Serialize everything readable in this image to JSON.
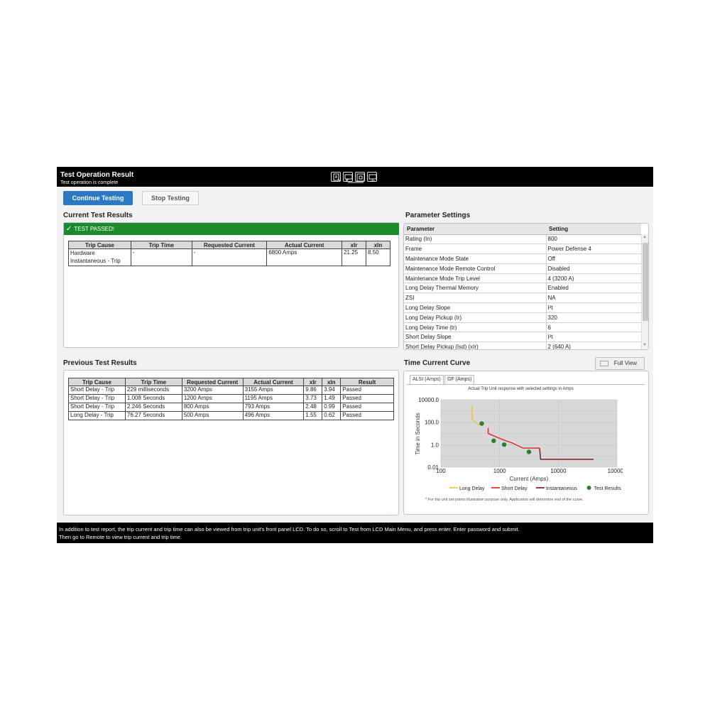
{
  "window": {
    "title": "Test Operation Result",
    "subtitle": "Test operation is complete"
  },
  "toolbar": {
    "icons": [
      "report-icon",
      "comment-icon",
      "screen-icon",
      "monitor-icon"
    ]
  },
  "buttons": {
    "continue_label": "Continue Testing",
    "stop_label": "Stop Testing",
    "full_view_label": "Full View"
  },
  "current_results": {
    "heading": "Current Test Results",
    "status": "TEST PASSED!",
    "status_color": "#1b8a2b",
    "columns": [
      "Trip Cause",
      "Trip Time",
      "Requested Current",
      "Actual Current",
      "xIr",
      "xIn"
    ],
    "rows": [
      [
        "Hardware Instantaneous - Trip",
        "-",
        "-",
        "6800 Amps",
        "21.25",
        "8.50"
      ]
    ]
  },
  "parameters": {
    "heading": "Parameter Settings",
    "columns": [
      "Parameter",
      "Setting"
    ],
    "rows": [
      [
        "Rating (In)",
        "800"
      ],
      [
        "Frame",
        "Power Defense 4"
      ],
      [
        "Maintenance Mode State",
        "Off"
      ],
      [
        "Maintenance Mode Remote Control",
        "Disabled"
      ],
      [
        "Maintenance Mode Trip Level",
        "4 (3200 A)"
      ],
      [
        "Long Delay Thermal Memory",
        "Enabled"
      ],
      [
        "ZSI",
        "NA"
      ],
      [
        "Long Delay Slope",
        "I²t"
      ],
      [
        "Long Delay Pickup (Ir)",
        "320"
      ],
      [
        "Long Delay Time (tr)",
        "6"
      ],
      [
        "Short Delay Slope",
        "I²t"
      ],
      [
        "Short Delay Pickup (Isd) (xIr)",
        "2 (640 A)"
      ]
    ]
  },
  "previous_results": {
    "heading": "Previous Test Results",
    "columns": [
      "Trip Cause",
      "Trip Time",
      "Requested Current",
      "Actual Current",
      "xIr",
      "xIn",
      "Result"
    ],
    "rows": [
      [
        "Short Delay - Trip",
        "229  milliseconds",
        "3200 Amps",
        "3155 Amps",
        "9.86",
        "3.94",
        "Passed"
      ],
      [
        "Short Delay - Trip",
        "1.008 Seconds",
        "1200 Amps",
        "1195 Amps",
        "3.73",
        "1.49",
        "Passed"
      ],
      [
        "Short Delay - Trip",
        "2.246 Seconds",
        "800 Amps",
        "793 Amps",
        "2.48",
        "0.99",
        "Passed"
      ],
      [
        "Long Delay - Trip",
        "76.27 Seconds",
        "500 Amps",
        "496 Amps",
        "1.55",
        "0.62",
        "Passed"
      ]
    ]
  },
  "curve": {
    "heading": "Time Current Curve",
    "tabs": [
      "ALSI (Amps)",
      "GF (Amps)"
    ],
    "caption": "Actual Trip Unit response with selected settings in Amps",
    "note": "* For trip unit set points illustration purpose only. Application will determine end of the curve."
  },
  "chart_data": {
    "type": "line",
    "xlabel": "Current (Amps)",
    "ylabel": "Time in Seconds",
    "xscale": "log",
    "yscale": "log",
    "xlim": [
      100,
      100000
    ],
    "ylim": [
      0.01,
      10000
    ],
    "x_ticks": [
      "100",
      "1000",
      "10000",
      "100000"
    ],
    "y_ticks": [
      "0.01",
      "1.0",
      "100.0",
      "10000.0"
    ],
    "legend_position": "bottom",
    "series": [
      {
        "name": "Long Delay",
        "color": "#f0c419",
        "points": [
          [
            340,
            3000
          ],
          [
            340,
            200
          ],
          [
            400,
            80
          ],
          [
            500,
            50
          ]
        ]
      },
      {
        "name": "Short Delay",
        "color": "#e02020",
        "points": [
          [
            640,
            30
          ],
          [
            640,
            10
          ],
          [
            800,
            6
          ],
          [
            1200,
            2.5
          ],
          [
            1600,
            1.5
          ],
          [
            2500,
            0.5
          ],
          [
            4800,
            0.5
          ]
        ]
      },
      {
        "name": "Instantaneous",
        "color": "#7a0f0f",
        "points": [
          [
            4800,
            0.5
          ],
          [
            5000,
            0.05
          ],
          [
            40000,
            0.05
          ]
        ]
      }
    ],
    "test_results": {
      "name": "Test Results",
      "color": "#2e7d32",
      "points": [
        [
          496,
          76.27
        ],
        [
          793,
          2.246
        ],
        [
          1195,
          1.008
        ],
        [
          3155,
          0.229
        ]
      ]
    }
  },
  "footer": {
    "line1": "In addition to test report, the trip current and trip time can also be viewed from trip unit's front panel LCD.  To do so, scroll to Test from LCD Main Menu, and press enter. Enter password and submit.",
    "line2": "Then go to Remote to view trip current and trip time."
  }
}
